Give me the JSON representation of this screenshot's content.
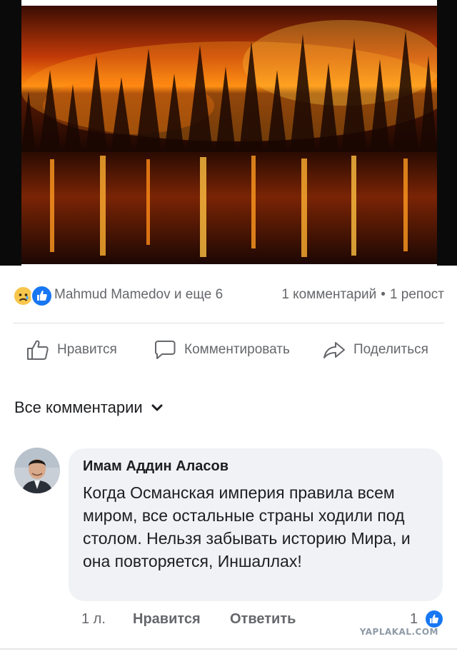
{
  "post": {
    "image_description": "",
    "reactions": {
      "icons": [
        "sad-reaction-icon",
        "like-reaction-icon"
      ],
      "names": "Mahmud Mamedov и еще 6",
      "comments": "1 комментарий",
      "dot": "•",
      "shares": "1 репост"
    },
    "actions": {
      "like": "Нравится",
      "comment": "Комментировать",
      "share": "Поделиться"
    }
  },
  "comments_section": {
    "filter_label": "Все комментарии",
    "comments": [
      {
        "author": "Имам Аддин Аласов",
        "text": "Когда Османская империя правила всем миром, все остальные страны ходили под столом. Нельзя забывать историю Мира, и она повторяется, Иншаллах!",
        "time": "1 л.",
        "like_label": "Нравится",
        "reply_label": "Ответить",
        "like_count": "1"
      }
    ]
  },
  "watermark": "YAPLAKAL.COM",
  "colors": {
    "accent": "#1877f2",
    "secondary_text": "#65676b",
    "bubble": "#f0f2f5"
  }
}
